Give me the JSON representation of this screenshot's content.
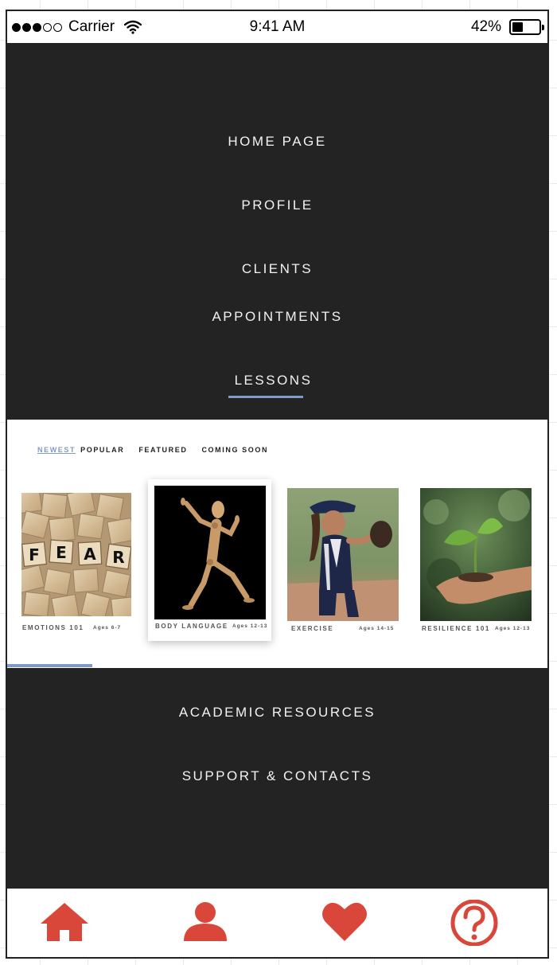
{
  "status_bar": {
    "carrier": "Carrier",
    "time": "9:41 AM",
    "battery": "42%",
    "signal_icon": "signal-dots-icon",
    "wifi_icon": "wifi-icon",
    "battery_icon": "battery-icon"
  },
  "menu": {
    "home": "HOME PAGE",
    "profile": "PROFILE",
    "clients": "CLIENTS",
    "appointments": "APPOINTMENTS",
    "lessons": "LESSONS",
    "academic": "ACADEMIC RESOURCES",
    "support": "SUPPORT & CONTACTS"
  },
  "lessons": {
    "filters": [
      "NEWEST",
      "POPULAR",
      "FEATURED",
      "COMING SOON"
    ],
    "active_filter": "NEWEST",
    "cards": [
      {
        "title": "EMOTIONS 101",
        "ages": "Ages 6-7"
      },
      {
        "title": "BODY LANGUAGE",
        "ages": "Ages 12-13"
      },
      {
        "title": "EXERCISE",
        "ages": "Ages 14-15"
      },
      {
        "title": "RESILIENCE 101",
        "ages": "Ages 12-13"
      }
    ],
    "scrabble_tiles": [
      "F",
      "E",
      "A",
      "R"
    ]
  },
  "tab_bar": {
    "items": [
      "home-icon",
      "user-icon",
      "heart-icon",
      "help-icon"
    ],
    "accent_color": "#d9473a"
  },
  "colors": {
    "menu_bg": "#232323",
    "menu_text": "#f2f2f2",
    "accent_blue": "#7f9bcc"
  }
}
